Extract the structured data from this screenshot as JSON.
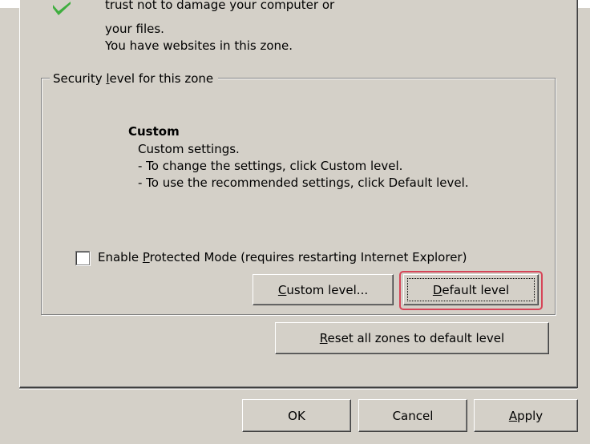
{
  "zone_description": {
    "line1": "trust not to damage your computer or",
    "line2": "your files.",
    "line3": "You have websites in this zone."
  },
  "security_group": {
    "legend_pre": "Security ",
    "legend_key": "l",
    "legend_post": "evel for this zone",
    "level_title": "Custom",
    "level_lines": [
      "Custom settings.",
      "- To change the settings, click Custom level.",
      "- To use the recommended settings, click Default level."
    ],
    "protected_mode": {
      "checked": false,
      "label_pre": "Enable ",
      "label_key": "P",
      "label_post": "rotected Mode (requires restarting Internet Explorer)"
    },
    "custom_level_button": {
      "key": "C",
      "rest": "ustom level..."
    },
    "default_level_button": {
      "key": "D",
      "rest": "efault level"
    }
  },
  "reset_button": {
    "key": "R",
    "rest": "eset all zones to default level"
  },
  "footer": {
    "ok_label": "OK",
    "cancel_label": "Cancel",
    "apply_key": "A",
    "apply_rest": "pply"
  },
  "colors": {
    "dialog_bg": "#d4d0c8",
    "highlight": "#d64558",
    "zone_icon": "#3fae3f"
  },
  "icons": {
    "zone_icon": "green-checkmark-icon"
  }
}
